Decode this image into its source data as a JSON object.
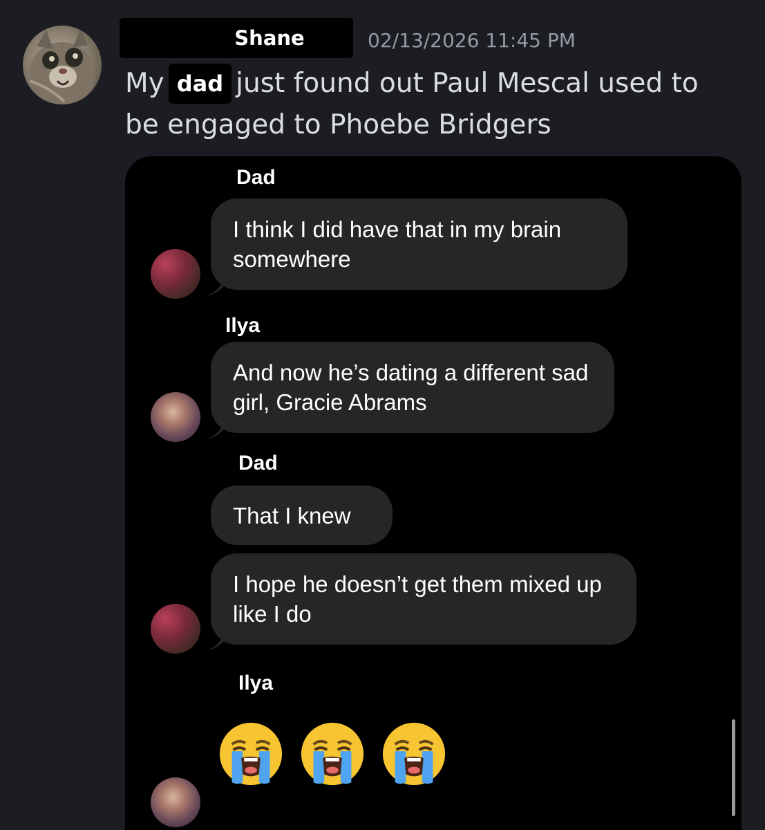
{
  "post": {
    "author": "Shane",
    "timestamp": "02/13/2026 11:45 PM",
    "message": {
      "before": "My",
      "highlight": "dad",
      "after": "just found out Paul Mescal used to be engaged to Phoebe Bridgers"
    }
  },
  "thread": [
    {
      "sender": "Dad",
      "avatar": "dad-avatar",
      "messages": [
        "I think I did have that in my brain somewhere"
      ]
    },
    {
      "sender": "Ilya",
      "avatar": "ilya-avatar",
      "messages": [
        "And now he’s dating a different sad girl, Gracie Abrams"
      ]
    },
    {
      "sender": "Dad",
      "avatar": "dad-avatar",
      "messages": [
        "That I knew",
        "I hope he doesn’t get them mixed up like I do"
      ]
    },
    {
      "sender": "Ilya",
      "avatar": "ilya-avatar",
      "messages": [
        "loudly-crying-face-emoji x3"
      ]
    }
  ],
  "colors": {
    "background": "#1c1d22",
    "bubble": "#262628",
    "timestamp": "#949ba4"
  }
}
